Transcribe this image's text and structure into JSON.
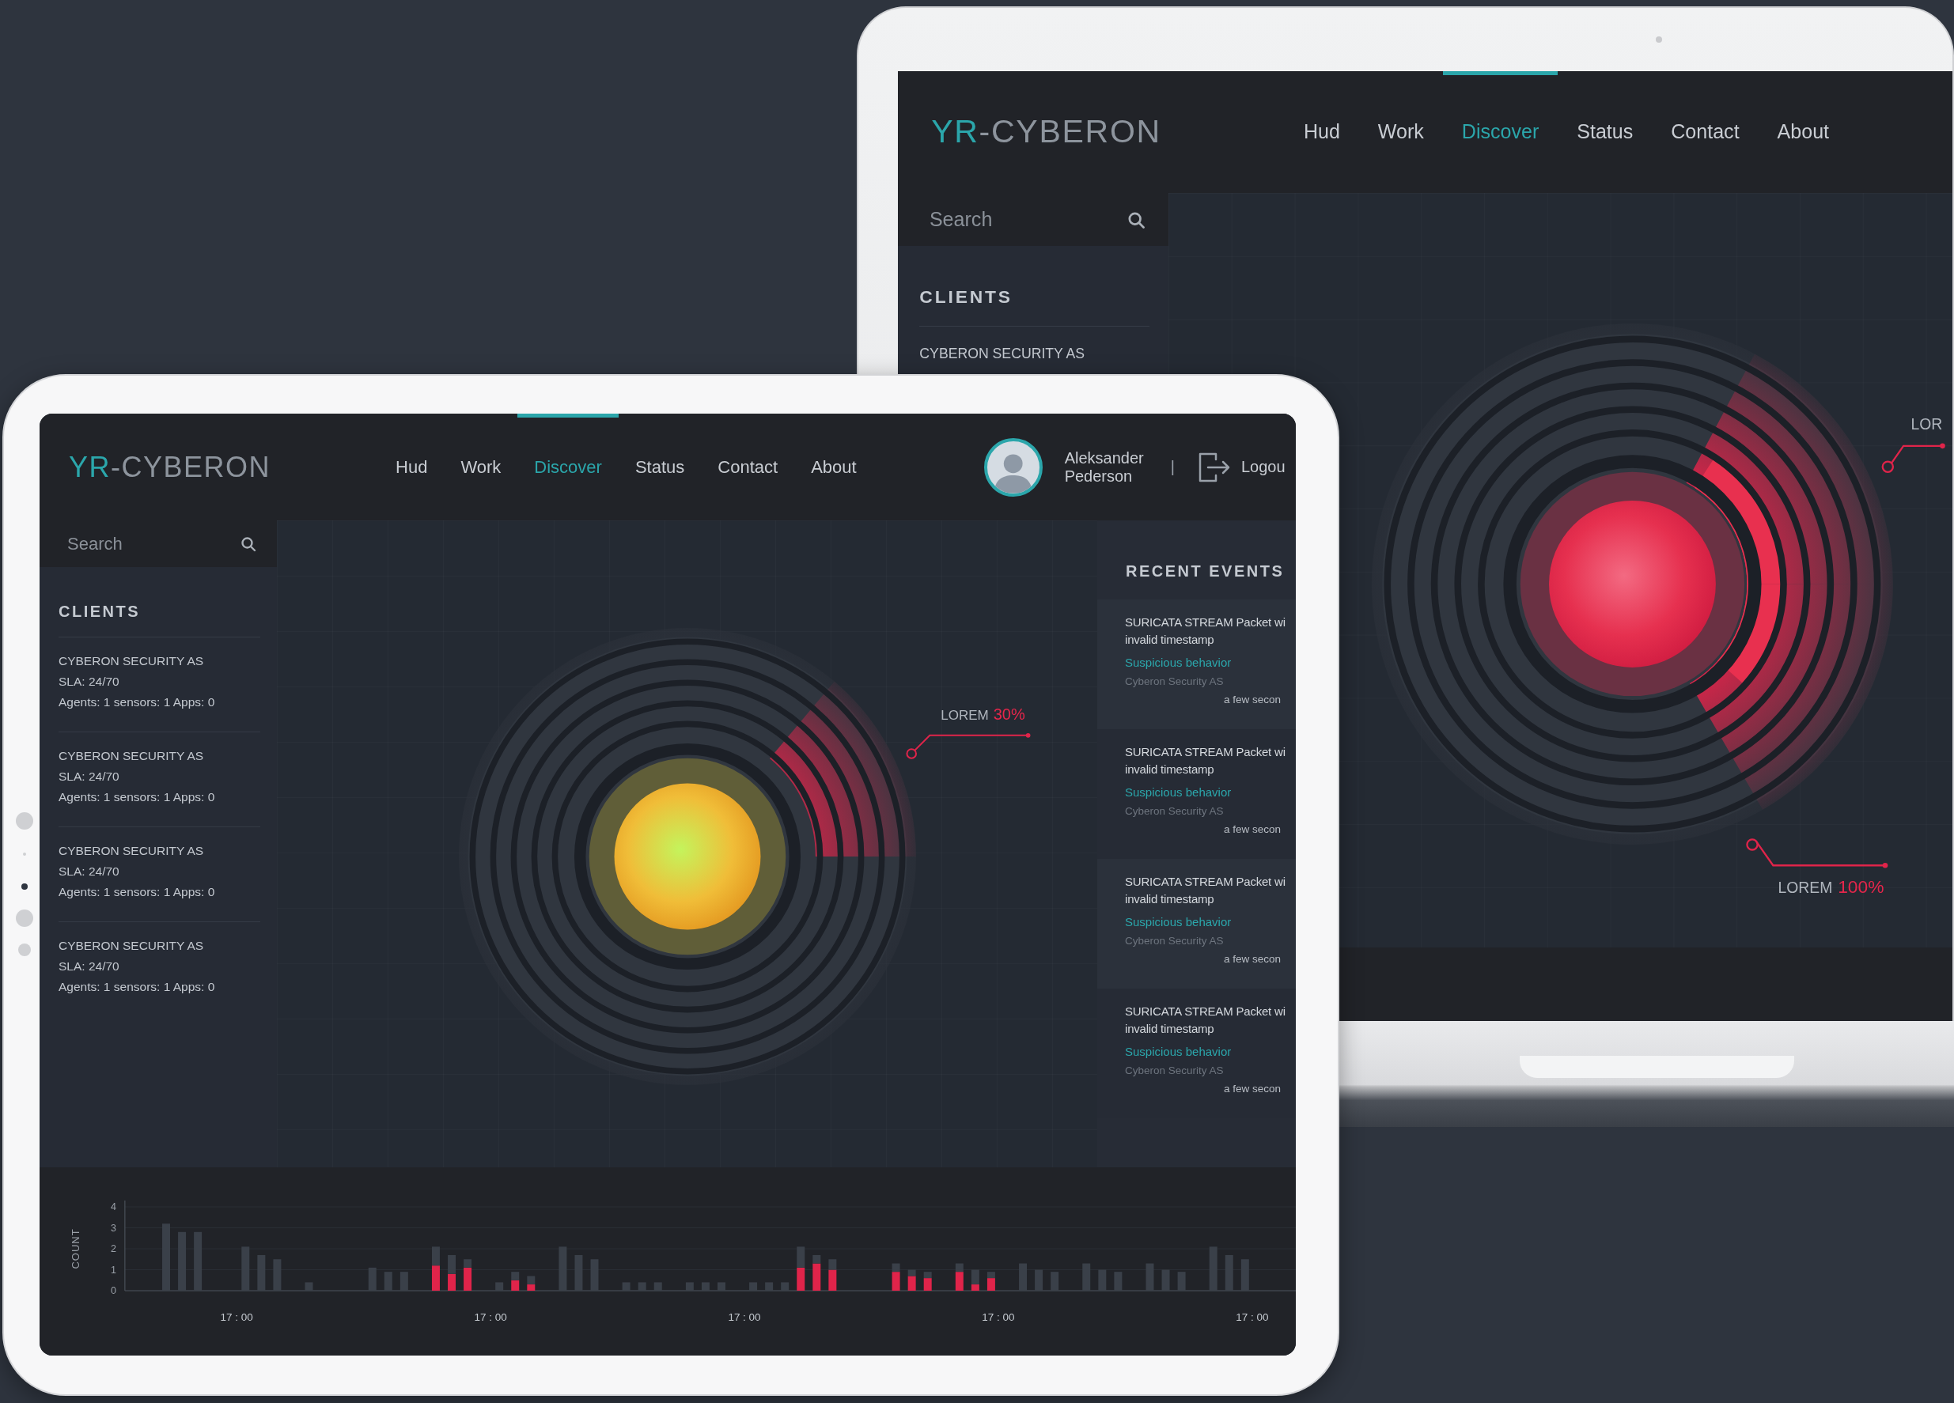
{
  "laptop": {
    "logo": {
      "accent": "YR",
      "text": "-CYBERON"
    },
    "nav": [
      {
        "label": "Hud",
        "selected": false
      },
      {
        "label": "Work",
        "selected": false
      },
      {
        "label": "Discover",
        "selected": true
      },
      {
        "label": "Status",
        "selected": false
      },
      {
        "label": "Contact",
        "selected": false
      },
      {
        "label": "About",
        "selected": false
      }
    ],
    "search": {
      "placeholder": "Search"
    },
    "clients": {
      "heading": "CLIENTS",
      "items": [
        {
          "name": "CYBERON SECURITY AS"
        }
      ]
    },
    "radar": {
      "alert": true,
      "callouts": [
        {
          "label": "LOR"
        },
        {
          "label": "LOREM",
          "value": "100%"
        }
      ]
    }
  },
  "tablet": {
    "logo": {
      "accent": "YR",
      "text": "-CYBERON"
    },
    "nav": [
      {
        "label": "Hud",
        "selected": false
      },
      {
        "label": "Work",
        "selected": false
      },
      {
        "label": "Discover",
        "selected": true
      },
      {
        "label": "Status",
        "selected": false
      },
      {
        "label": "Contact",
        "selected": false
      },
      {
        "label": "About",
        "selected": false
      }
    ],
    "user": {
      "name": "Aleksander Pederson",
      "separator": "|",
      "logout": "Logou"
    },
    "search": {
      "placeholder": "Search"
    },
    "clients": {
      "heading": "CLIENTS",
      "items": [
        {
          "name": "CYBERON SECURITY AS",
          "sla": "SLA: 24/70",
          "counts": "Agents: 1 sensors: 1 Apps: 0"
        },
        {
          "name": "CYBERON SECURITY AS",
          "sla": "SLA: 24/70",
          "counts": "Agents: 1 sensors: 1 Apps: 0"
        },
        {
          "name": "CYBERON SECURITY AS",
          "sla": "SLA: 24/70",
          "counts": "Agents: 1 sensors: 1 Apps: 0"
        },
        {
          "name": "CYBERON SECURITY AS",
          "sla": "SLA: 24/70",
          "counts": "Agents: 1 sensors: 1 Apps: 0"
        }
      ]
    },
    "radar": {
      "alert": false,
      "callouts": [
        {
          "label": "LOREM",
          "value": "30%"
        }
      ]
    },
    "recent_events": {
      "heading": "RECENT EVENTS",
      "items": [
        {
          "title_lines": [
            "SURICATA STREAM Packet wi",
            "invalid timestamp"
          ],
          "category": "Suspicious behavior",
          "client": "Cyberon Security AS",
          "time": "a few secon"
        },
        {
          "title_lines": [
            "SURICATA STREAM Packet wi",
            "invalid timestamp"
          ],
          "category": "Suspicious behavior",
          "client": "Cyberon Security AS",
          "time": "a few secon"
        },
        {
          "title_lines": [
            "SURICATA STREAM Packet wi",
            "invalid timestamp"
          ],
          "category": "Suspicious behavior",
          "client": "Cyberon Security AS",
          "time": "a few secon"
        },
        {
          "title_lines": [
            "SURICATA STREAM Packet wi",
            "invalid timestamp"
          ],
          "category": "Suspicious behavior",
          "client": "Cyberon Security AS",
          "time": "a few secon"
        }
      ]
    },
    "activity": {
      "chart_data": {
        "type": "bar",
        "stacked": true,
        "ylabel": "COUNT",
        "categories": [
          null,
          null,
          null,
          null,
          "17 : 00",
          null,
          null,
          null,
          null,
          null,
          null,
          null,
          null,
          null,
          null,
          null,
          null,
          null,
          null,
          null,
          "17 : 00",
          null,
          null,
          null,
          null,
          null,
          null,
          null,
          null,
          null,
          null,
          null,
          null,
          null,
          null,
          null,
          "17 : 00",
          null,
          null,
          null,
          null,
          null,
          null,
          null,
          null,
          null,
          null,
          null,
          null,
          null,
          null,
          null,
          "17 : 00",
          null,
          null,
          null,
          null,
          null,
          null,
          null,
          null,
          null,
          null,
          null,
          null,
          null,
          null,
          null,
          "17 : 00"
        ],
        "series": [
          {
            "color": "#e0244a",
            "values": [
              0,
              0,
              0,
              null,
              null,
              0,
              0,
              0,
              null,
              0,
              null,
              null,
              null,
              0,
              0,
              0,
              null,
              1.2,
              0.8,
              1.1,
              null,
              0,
              0.5,
              0.3,
              null,
              0,
              0,
              0,
              null,
              0,
              0,
              0,
              null,
              0,
              0,
              0,
              null,
              0,
              0,
              0,
              1.1,
              1.3,
              1.0,
              null,
              null,
              null,
              0.9,
              0.7,
              0.6,
              null,
              0.9,
              0.3,
              0.6,
              null,
              0,
              0,
              0,
              null,
              0,
              0,
              0,
              null,
              0,
              0,
              0,
              null,
              0,
              0,
              0
            ]
          },
          {
            "color": "#3a4049",
            "values": [
              3.2,
              2.8,
              2.8,
              null,
              null,
              2.1,
              1.7,
              1.5,
              null,
              0.4,
              null,
              null,
              null,
              1.1,
              0.9,
              0.9,
              null,
              0.9,
              0.9,
              0.4,
              null,
              0.4,
              0.4,
              0.4,
              null,
              2.1,
              1.7,
              1.5,
              null,
              0.4,
              0.4,
              0.4,
              null,
              0.4,
              0.4,
              0.4,
              null,
              0.4,
              0.4,
              0.4,
              1.0,
              0.4,
              0.5,
              null,
              null,
              null,
              0.4,
              0.3,
              0.3,
              null,
              0.4,
              0.7,
              0.3,
              null,
              1.3,
              1.0,
              0.9,
              null,
              1.3,
              1.0,
              0.9,
              null,
              1.3,
              1.0,
              0.9,
              null,
              2.1,
              1.7,
              1.5
            ]
          }
        ],
        "ylim": [
          0,
          4.3
        ],
        "yticks": [
          0,
          1,
          2,
          3,
          4
        ],
        "grid": true
      }
    }
  }
}
